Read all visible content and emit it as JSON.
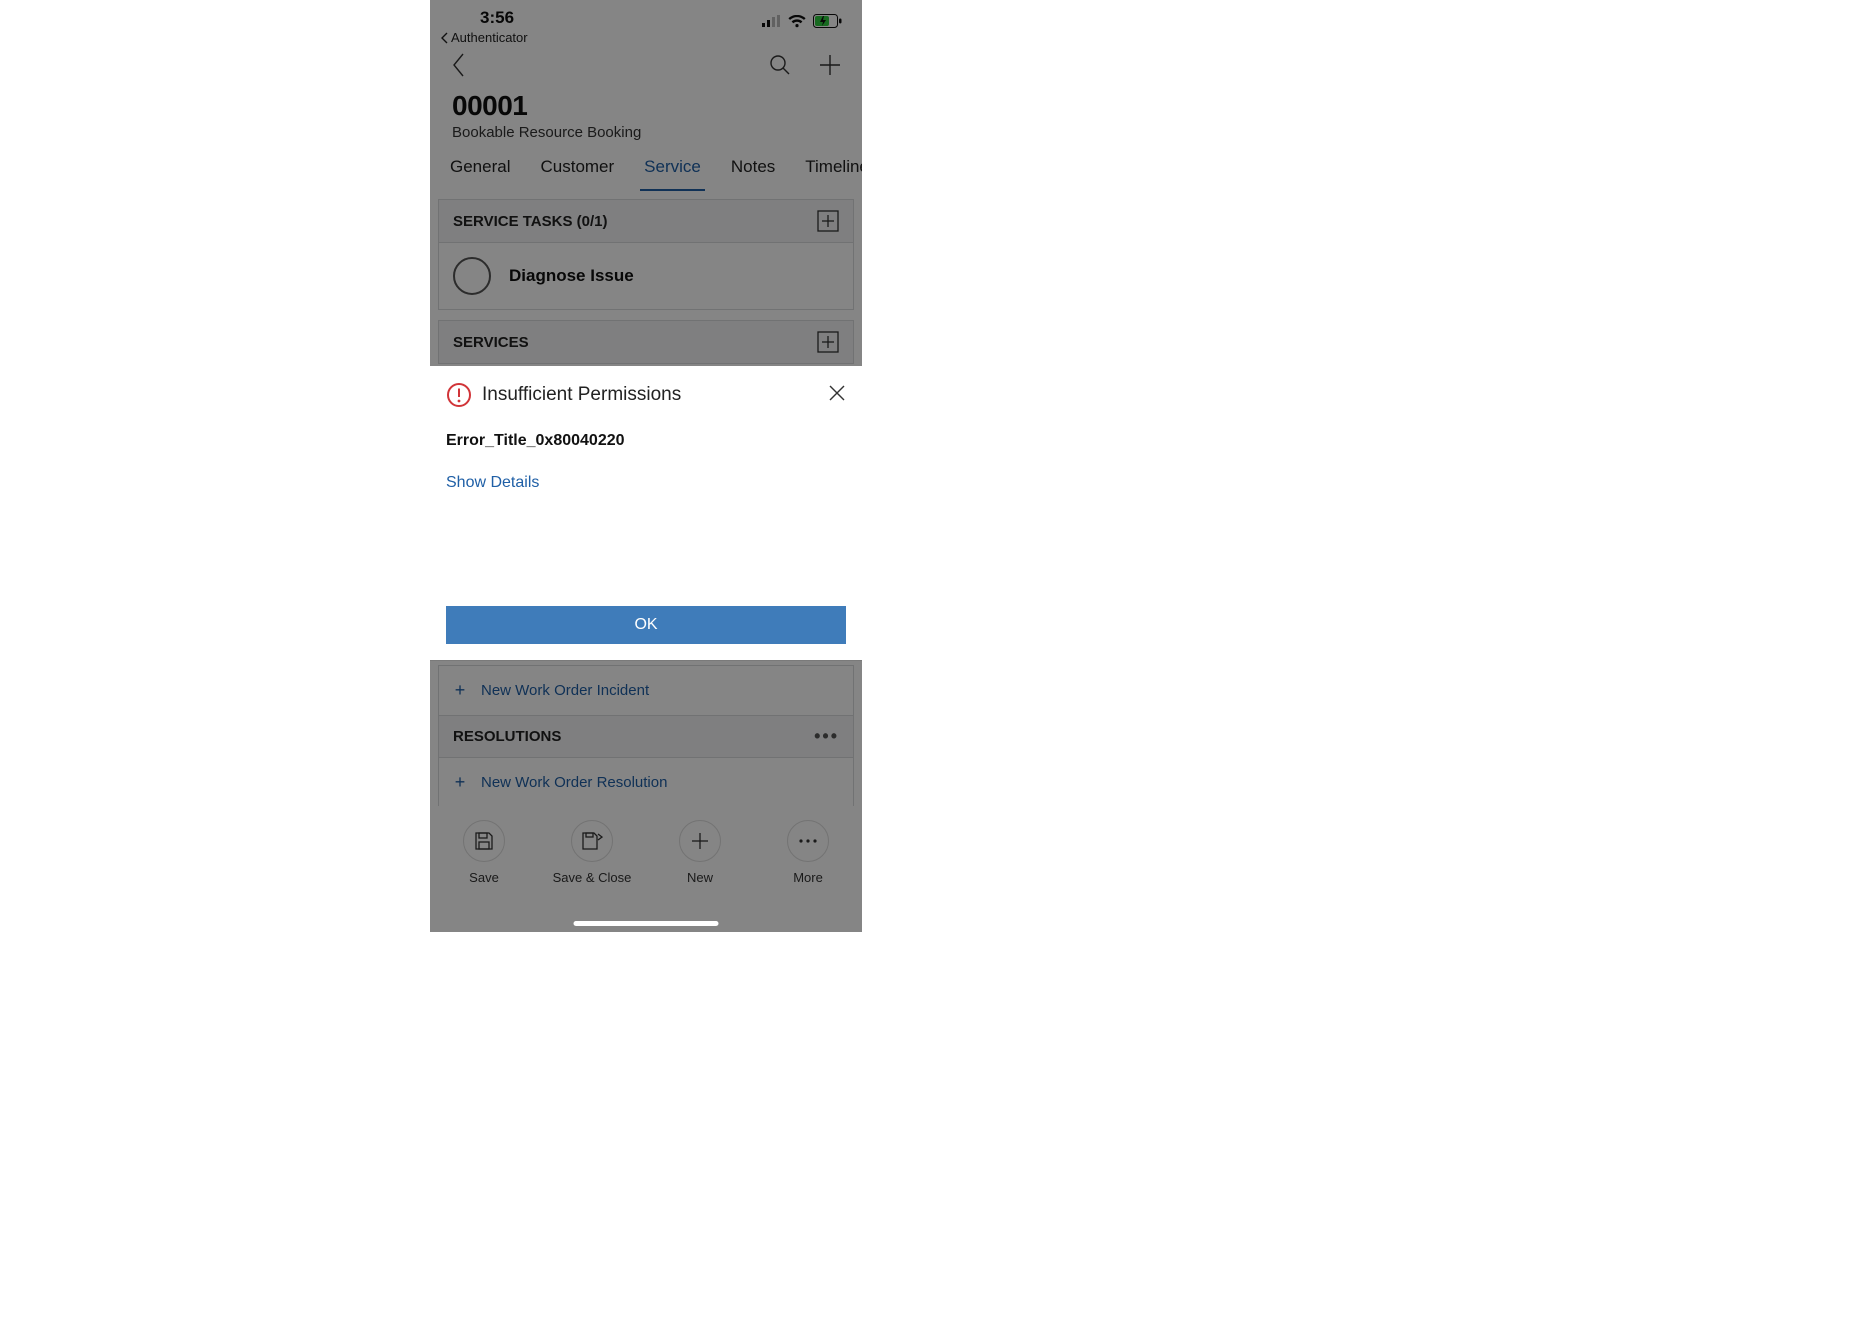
{
  "status": {
    "time": "3:56",
    "back_app": "Authenticator"
  },
  "header": {
    "title": "00001",
    "subtitle": "Bookable Resource Booking"
  },
  "tabs": [
    "General",
    "Customer",
    "Service",
    "Notes",
    "Timeline"
  ],
  "active_tab_index": 2,
  "sections": {
    "service_tasks_header": "SERVICE TASKS (0/1)",
    "task_item": "Diagnose Issue",
    "services_header": "SERVICES",
    "resolutions_header": "RESOLUTIONS",
    "link_incident": "New Work Order Incident",
    "link_resolution": "New Work Order Resolution"
  },
  "dialog": {
    "title": "Insufficient Permissions",
    "error_code": "Error_Title_0x80040220",
    "show_details": "Show Details",
    "ok": "OK"
  },
  "bottom": [
    {
      "label": "Save"
    },
    {
      "label": "Save & Close"
    },
    {
      "label": "New"
    },
    {
      "label": "More"
    }
  ],
  "colors": {
    "accent": "#1f5fa6",
    "button": "#3f7cba",
    "error": "#d13438"
  }
}
